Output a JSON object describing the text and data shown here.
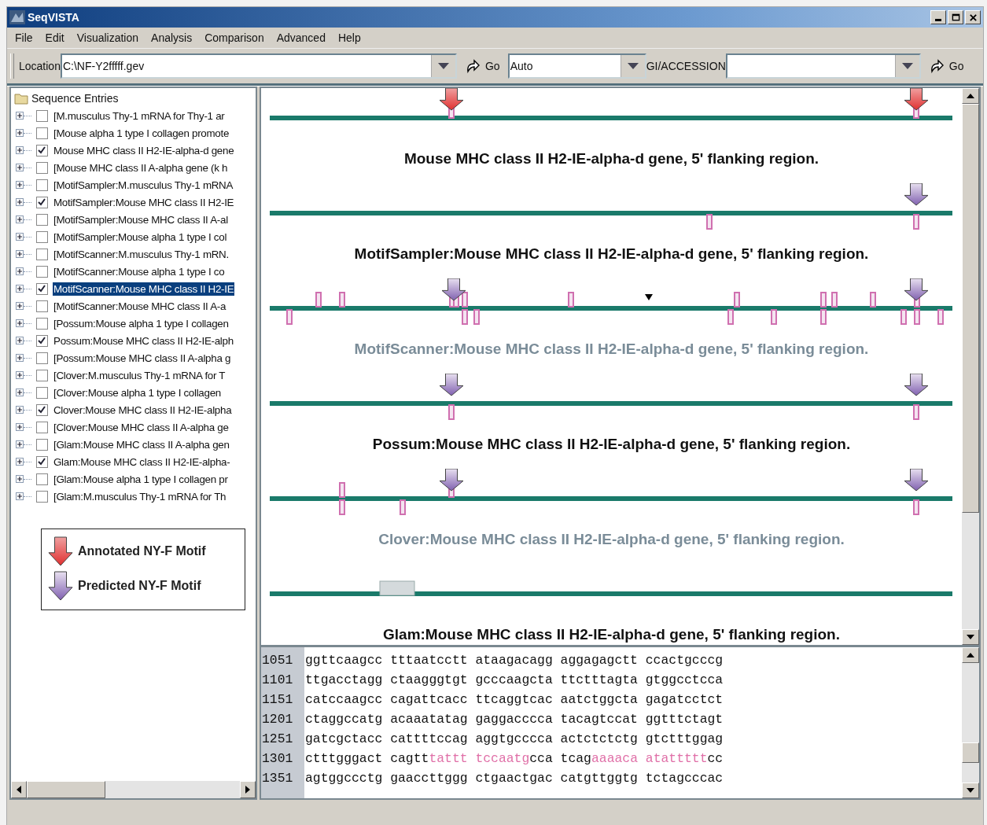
{
  "window": {
    "title": "SeqVISTA"
  },
  "menu": [
    "File",
    "Edit",
    "Visualization",
    "Analysis",
    "Comparison",
    "Advanced",
    "Help"
  ],
  "toolbar": {
    "location_label": "Location",
    "location_value": "C:\\NF-Y2fffff.gev",
    "go_label": "Go",
    "mode_value": "Auto",
    "accession_label": "GI/ACCESSION",
    "go2_label": "Go"
  },
  "tree": {
    "root": "Sequence Entries",
    "items": [
      {
        "label": "[M.musculus Thy-1 mRNA for Thy-1 ar",
        "checked": false,
        "selected": false
      },
      {
        "label": "[Mouse alpha 1 type I collagen promote",
        "checked": false,
        "selected": false
      },
      {
        "label": "Mouse MHC class II H2-IE-alpha-d gene",
        "checked": true,
        "selected": false
      },
      {
        "label": "[Mouse MHC class II A-alpha gene (k h",
        "checked": false,
        "selected": false
      },
      {
        "label": "[MotifSampler:M.musculus Thy-1 mRNA",
        "checked": false,
        "selected": false
      },
      {
        "label": "MotifSampler:Mouse MHC class II H2-IE",
        "checked": true,
        "selected": false
      },
      {
        "label": "[MotifSampler:Mouse MHC class II A-al",
        "checked": false,
        "selected": false
      },
      {
        "label": "[MotifSampler:Mouse alpha 1 type I col",
        "checked": false,
        "selected": false
      },
      {
        "label": "[MotifScanner:M.musculus Thy-1 mRN.",
        "checked": false,
        "selected": false
      },
      {
        "label": "[MotifScanner:Mouse alpha 1 type I co",
        "checked": false,
        "selected": false
      },
      {
        "label": "MotifScanner:Mouse MHC class II H2-IE",
        "checked": true,
        "selected": true
      },
      {
        "label": "[MotifScanner:Mouse MHC class II A-a",
        "checked": false,
        "selected": false
      },
      {
        "label": "[Possum:Mouse alpha 1 type I collagen",
        "checked": false,
        "selected": false
      },
      {
        "label": "Possum:Mouse MHC class II H2-IE-alph",
        "checked": true,
        "selected": false
      },
      {
        "label": "[Possum:Mouse MHC class II A-alpha g",
        "checked": false,
        "selected": false
      },
      {
        "label": "[Clover:M.musculus Thy-1 mRNA for T",
        "checked": false,
        "selected": false
      },
      {
        "label": "[Clover:Mouse alpha 1 type I collagen",
        "checked": false,
        "selected": false
      },
      {
        "label": "Clover:Mouse MHC class II H2-IE-alpha",
        "checked": true,
        "selected": false
      },
      {
        "label": "[Clover:Mouse MHC class II A-alpha ge",
        "checked": false,
        "selected": false
      },
      {
        "label": "[Glam:Mouse MHC class II A-alpha gen",
        "checked": false,
        "selected": false
      },
      {
        "label": "Glam:Mouse MHC class II H2-IE-alpha-",
        "checked": true,
        "selected": false
      },
      {
        "label": "[Glam:Mouse alpha 1 type I collagen pr",
        "checked": false,
        "selected": false
      },
      {
        "label": "[Glam:M.musculus Thy-1 mRNA for Th",
        "checked": false,
        "selected": false
      }
    ]
  },
  "legend": [
    {
      "kind": "annotated",
      "label": "Annotated NY-F Motif"
    },
    {
      "kind": "predicted",
      "label": "Predicted NY-F Motif"
    }
  ],
  "tracks": [
    {
      "title": "Mouse MHC class II H2-IE-alpha-d gene, 5' flanking region.",
      "dimmed": false
    },
    {
      "title": "MotifSampler:Mouse MHC class II H2-IE-alpha-d gene, 5' flanking region.",
      "dimmed": false
    },
    {
      "title": "MotifScanner:Mouse MHC class II H2-IE-alpha-d gene, 5' flanking region.",
      "dimmed": true
    },
    {
      "title": "Possum:Mouse MHC class II H2-IE-alpha-d gene, 5' flanking region.",
      "dimmed": false
    },
    {
      "title": "Clover:Mouse MHC class II H2-IE-alpha-d gene, 5' flanking region.",
      "dimmed": true
    },
    {
      "title": "Glam:Mouse MHC class II H2-IE-alpha-d gene, 5' flanking region.",
      "dimmed": false
    }
  ],
  "sequence": [
    {
      "number": "1051",
      "segments": [
        {
          "kind": "plain",
          "text": "ggttcaagcc tttaatcctt ataagacagg aggagagctt ccactgcccg"
        }
      ]
    },
    {
      "number": "1101",
      "segments": [
        {
          "kind": "plain",
          "text": "ttgacctagg ctaagggtgt gcccaagcta ttctttagta gtggcctcca"
        }
      ]
    },
    {
      "number": "1151",
      "segments": [
        {
          "kind": "plain",
          "text": "catccaagcc cagattcacc ttcaggtcac aatctggcta gagatcctct"
        }
      ]
    },
    {
      "number": "1201",
      "segments": [
        {
          "kind": "plain",
          "text": "ctaggccatg acaaatatag gaggacccca tacagtccat ggtttctagt"
        }
      ]
    },
    {
      "number": "1251",
      "segments": [
        {
          "kind": "plain",
          "text": "gatcgctacc cattttccag aggtgcccca actctctctg gtctttggag"
        }
      ]
    },
    {
      "number": "1301",
      "segments": [
        {
          "kind": "plain",
          "text": "ctttgggact cagtt"
        },
        {
          "kind": "motif",
          "text": "tattt tccaatg"
        },
        {
          "kind": "plain",
          "text": "cca tcag"
        },
        {
          "kind": "motif",
          "text": "aaaaca atattttt"
        },
        {
          "kind": "plain",
          "text": "cc"
        }
      ]
    },
    {
      "number": "1351",
      "segments": [
        {
          "kind": "plain",
          "text": "agtggccctg gaaccttggg ctgaactgac catgttggtg tctagcccac"
        }
      ]
    }
  ]
}
